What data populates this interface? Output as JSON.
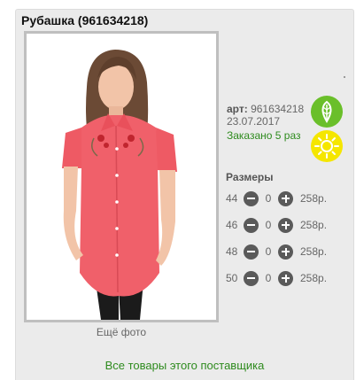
{
  "product": {
    "title": "Рубашка (961634218)",
    "art_label": "арт:",
    "art_value": "961634218",
    "date": "23.07.2017",
    "ordered": "Заказано 5 раз",
    "more_photo": "Ещё фото"
  },
  "icons": {
    "eco": "leaf-icon",
    "sun": "sun-icon",
    "eco_color": "#6abf2a",
    "sun_color": "#f5e600"
  },
  "sizes": {
    "title": "Размеры",
    "rows": [
      {
        "size": "44",
        "qty": "0",
        "price": "258р."
      },
      {
        "size": "46",
        "qty": "0",
        "price": "258р."
      },
      {
        "size": "48",
        "qty": "0",
        "price": "258р."
      },
      {
        "size": "50",
        "qty": "0",
        "price": "258р."
      }
    ]
  },
  "footer": {
    "supplier_link": "Все товары этого поставщика"
  },
  "colors": {
    "accent_green": "#2e8b1e",
    "shirt": "#f0606a",
    "panel": "#ebebeb"
  }
}
